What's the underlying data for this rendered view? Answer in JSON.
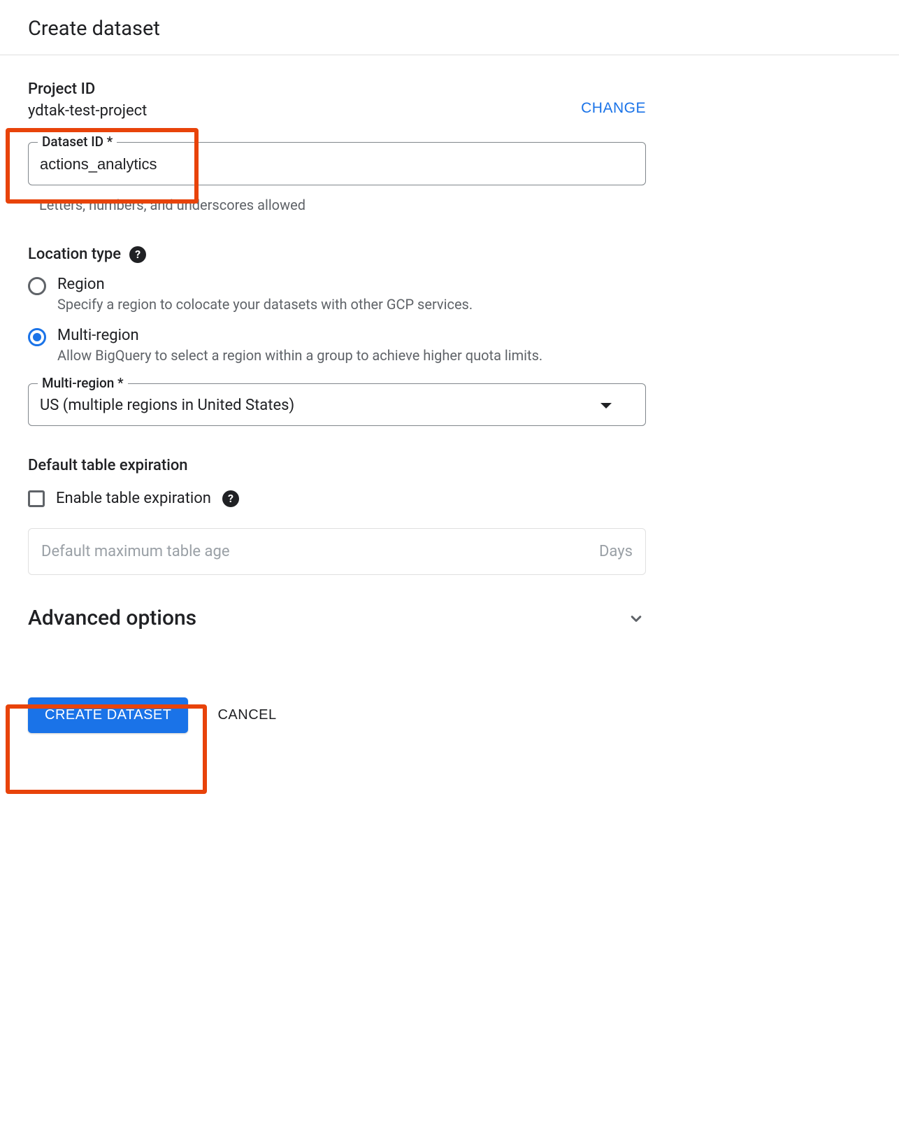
{
  "header": {
    "title": "Create dataset"
  },
  "project": {
    "label": "Project ID",
    "value": "ydtak-test-project",
    "change_label": "CHANGE"
  },
  "dataset_id": {
    "label": "Dataset ID *",
    "value": "actions_analytics",
    "helper": "Letters, numbers, and underscores allowed"
  },
  "location": {
    "heading": "Location type",
    "options": [
      {
        "title": "Region",
        "desc": "Specify a region to colocate your datasets with other GCP services.",
        "selected": false
      },
      {
        "title": "Multi-region",
        "desc": "Allow BigQuery to select a region within a group to achieve higher quota limits.",
        "selected": true
      }
    ],
    "multi_region_label": "Multi-region *",
    "multi_region_value": "US (multiple regions in United States)"
  },
  "expiration": {
    "heading": "Default table expiration",
    "checkbox_label": "Enable table expiration",
    "placeholder": "Default maximum table age",
    "unit": "Days"
  },
  "advanced": {
    "title": "Advanced options"
  },
  "actions": {
    "create_label": "CREATE DATASET",
    "cancel_label": "CANCEL"
  }
}
